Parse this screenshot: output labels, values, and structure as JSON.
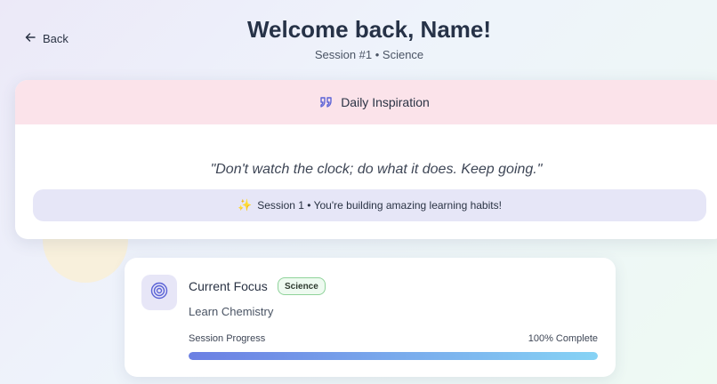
{
  "nav": {
    "back_label": "Back"
  },
  "header": {
    "title": "Welcome back, Name!",
    "subtitle": "Session #1 • Science"
  },
  "inspiration": {
    "heading": "Daily Inspiration",
    "quote": "\"Don't watch the clock; do what it does. Keep going.\"",
    "session_message": "Session 1 • You're building amazing learning habits!"
  },
  "focus": {
    "title": "Current Focus",
    "badge": "Science",
    "subject": "Learn Chemistry",
    "progress_label": "Session Progress",
    "progress_text": "100% Complete",
    "progress_fraction": 1.0
  },
  "icons": {
    "back": "arrow-left-icon",
    "quote": "quote-icon",
    "sparkle": "sparkle-icon",
    "target": "target-icon"
  },
  "colors": {
    "header_band": "#fbe3ea",
    "session_pill": "#e6e6f7",
    "badge_border": "#8fd39a",
    "progress_start": "#6b7fe3",
    "progress_end": "#86d3f5"
  }
}
